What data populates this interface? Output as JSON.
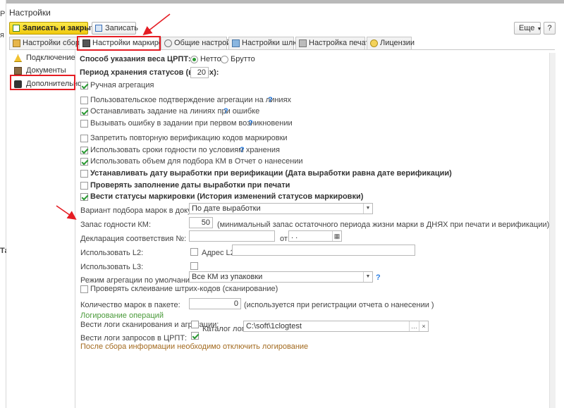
{
  "window": {
    "title": "Настройки",
    "left_letters": [
      "P",
      "я",
      "Та"
    ]
  },
  "toolbar": {
    "save_close": "Записать и закрыть",
    "save": "Записать",
    "more": "Еще",
    "help": "?"
  },
  "tabs": [
    {
      "label": "Настройки сборки",
      "active": false
    },
    {
      "label": "Настройки маркировки",
      "active": true
    },
    {
      "label": "Общие настройки",
      "active": false
    },
    {
      "label": "Настройки шлюз",
      "active": false
    },
    {
      "label": "Настройка печати",
      "active": false
    },
    {
      "label": "Лицензии",
      "active": false
    }
  ],
  "sidebar": {
    "items": [
      {
        "label": "Подключение"
      },
      {
        "label": "Документы"
      },
      {
        "label": "Дополнительно"
      }
    ]
  },
  "form": {
    "weight_label": "Способ указания веса ЦРПТ:",
    "weight_net": "Нетто",
    "weight_gross": "Брутто",
    "status_period_label": "Период хранения статусов (в днях):",
    "status_period_value": "20",
    "manual_aggregation": "Ручная агрегация",
    "user_confirm": "Пользовательское подтверждение агрегации на линиях",
    "stop_task": "Останавливать задание на линиях при ошибке",
    "call_error": "Вызывать ошибку в задании при первом возникновении",
    "forbid_reverify": "Запретить повторную верификацию кодов маркировки",
    "use_expiry": "Использовать сроки годности по условиям хранения",
    "use_volume": "Использовать объем для подбора КМ в Отчет о нанесении",
    "set_production_date": "Устанавливать дату выработки при верификации (Дата выработки равна дате верификации)",
    "check_production_date": "Проверять заполнение даты выработки при печати",
    "keep_statuses": "Вести статусы маркировки (История изменений статусов маркировки)",
    "variant_label": "Вариант подбора марок в документы:",
    "variant_value": "По дате выработки",
    "shelf_label": "Запас годности КМ:",
    "shelf_value": "50",
    "shelf_hint": "(минимальный запас остаточного периода жизни марки в ДНЯХ при печати и верификации)",
    "decl_label": "Декларация соответствия №:",
    "decl_value": "",
    "from_label": "от:",
    "date_value": ".  .",
    "use_l2_label": "Использовать L2:",
    "l2_addr_label": "Адрес L2:",
    "l2_addr_value": "",
    "use_l3_label": "Использовать L3:",
    "agg_mode_label": "Режим агрегации по умолчанию:",
    "agg_mode_value": "Все КМ из упаковки",
    "check_glue": "Проверять склеивание штрих-кодов (сканирование)",
    "pack_count_label": "Количество марок в пакете:",
    "pack_count_value": "0",
    "pack_count_hint": "(используется при регистрации  отчета о нанесении )",
    "logging_title": "Логирование операций",
    "log_scan_label": "Вести логи сканирования и агрегации:",
    "log_dir_label": "Каталог логов:",
    "log_dir_value": "C:\\soft\\1clogtest",
    "log_crpt_label": "Вести логи запросов в ЦРПТ:",
    "log_note": "После сбора информации необходимо отключить логирование"
  },
  "colors": {
    "accent_green": "#2b9a33",
    "primary_yellow": "#f0c90d",
    "highlight_red": "#e51c23",
    "help_blue": "#2a7de1",
    "section_green": "#4a9a3a",
    "note_brown": "#a36a1f"
  }
}
